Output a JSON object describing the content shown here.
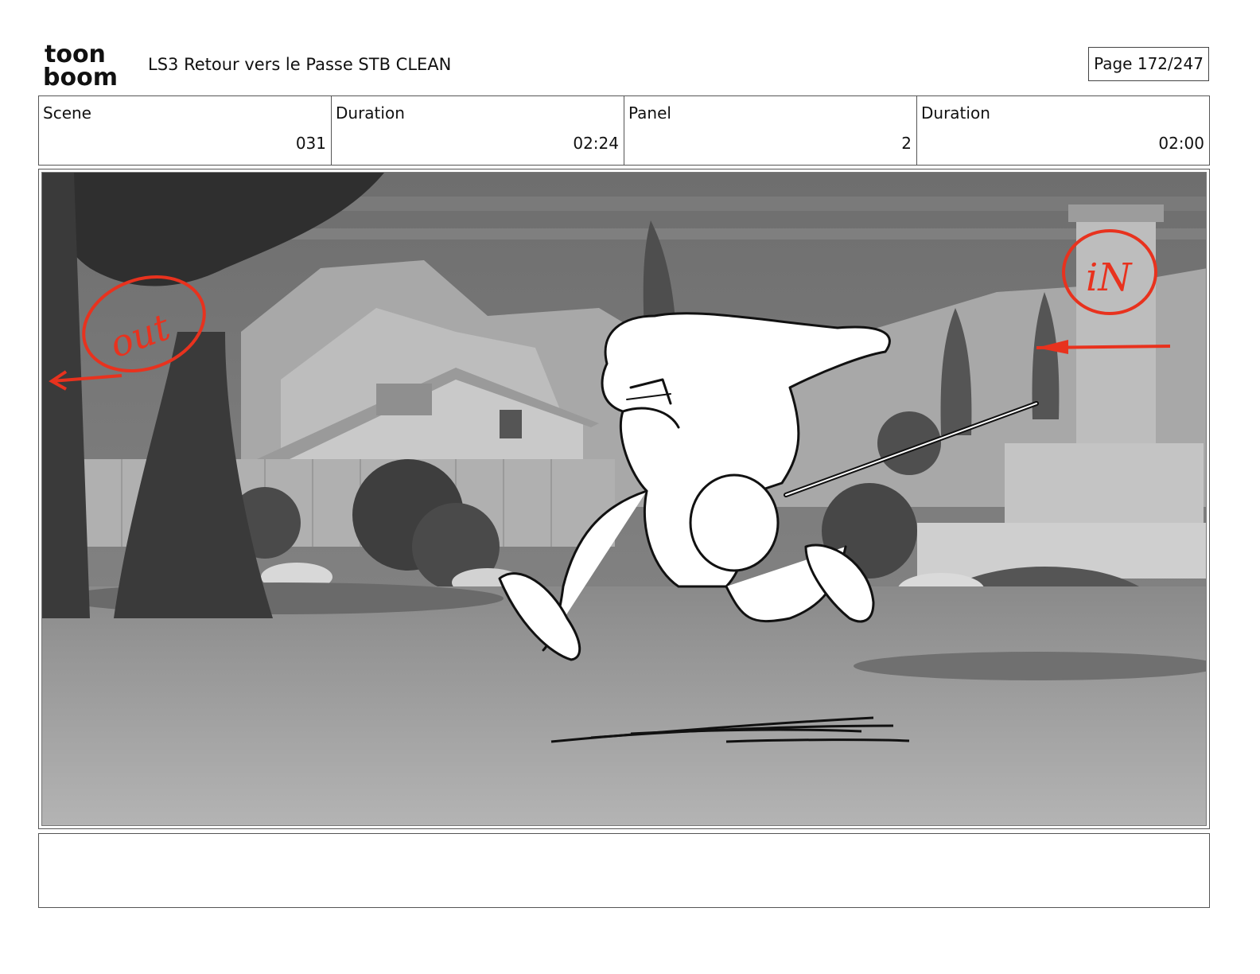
{
  "header": {
    "logo_top": "toon",
    "logo_bottom": "boom",
    "project_title": "LS3 Retour vers le Passe STB CLEAN",
    "page_indicator": "Page 172/247"
  },
  "info": {
    "scene_label": "Scene",
    "scene_value": "031",
    "scene_duration_label": "Duration",
    "scene_duration_value": "02:24",
    "panel_label": "Panel",
    "panel_value": "2",
    "panel_duration_label": "Duration",
    "panel_duration_value": "02:00"
  },
  "panel": {
    "annotation_out": "out",
    "annotation_in": "iN",
    "annotation_color": "#e8321e"
  },
  "notes": {
    "text": ""
  }
}
